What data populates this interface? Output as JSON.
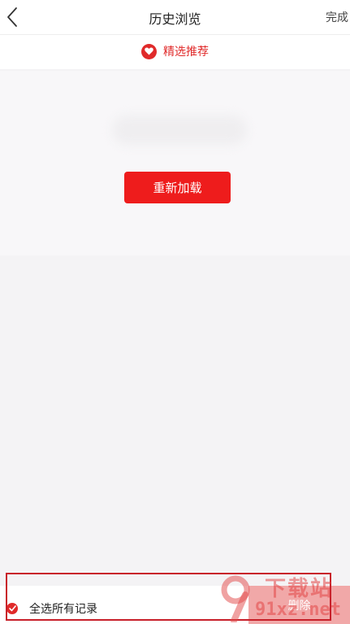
{
  "header": {
    "title": "历史浏览",
    "done_label": "完成",
    "back_icon": "chevron-left-icon"
  },
  "recommend": {
    "label": "精选推荐",
    "icon": "heart-icon",
    "accent_color": "#e02a2a"
  },
  "reload": {
    "button_label": "重新加载",
    "button_color": "#ee1c1c"
  },
  "bottom_bar": {
    "select_all_label": "全选所有记录",
    "select_all_checked": true,
    "delete_label": "删除",
    "delete_color": "#f1a8a8"
  },
  "watermark": {
    "line1": "下载站",
    "line2": "91xz.net"
  }
}
